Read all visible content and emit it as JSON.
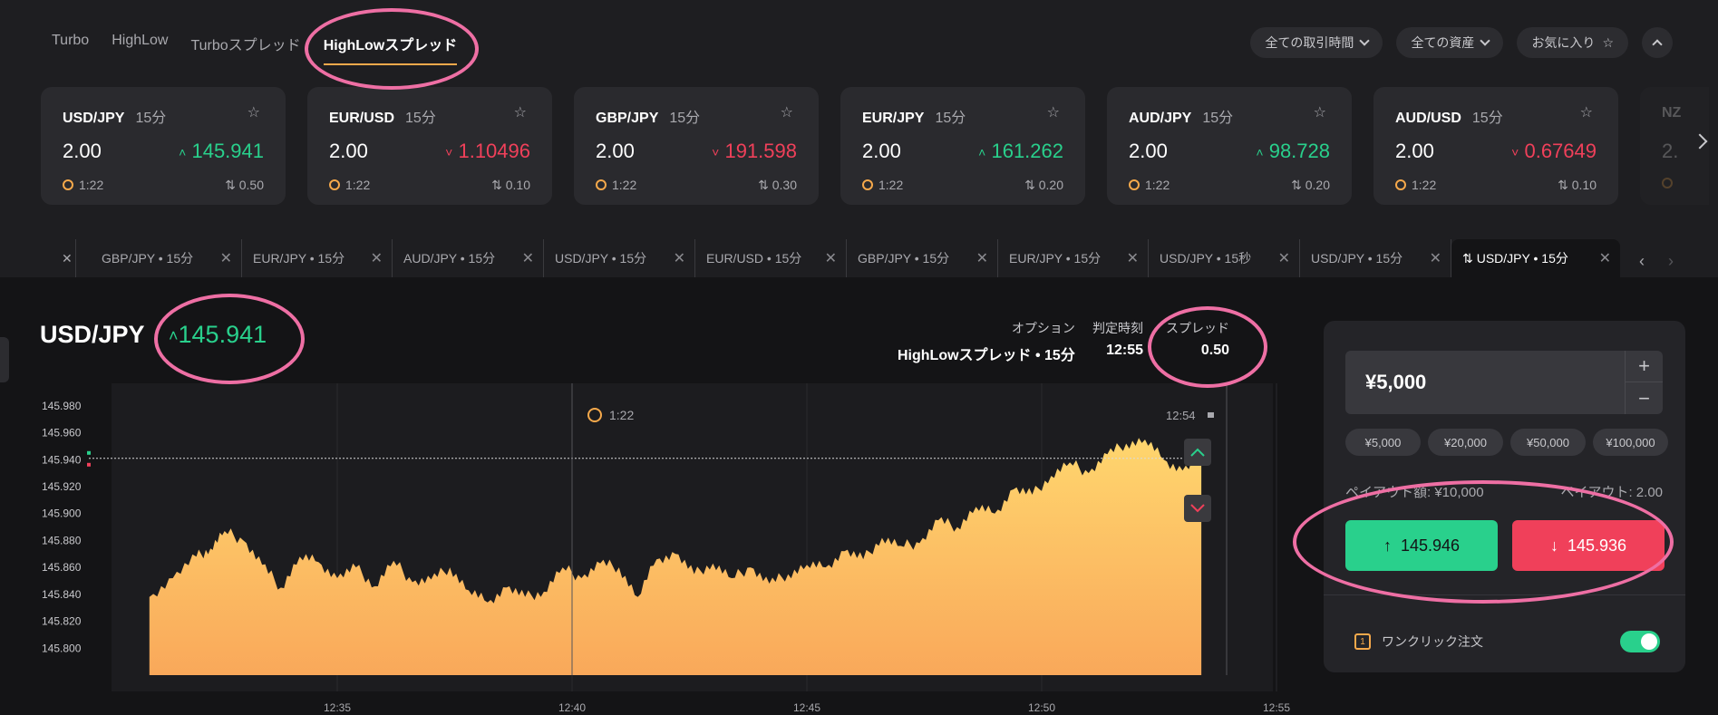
{
  "nav": {
    "tabs": [
      "Turbo",
      "HighLow",
      "Turboスプレッド",
      "HighLowスプレッド"
    ],
    "active_index": 3,
    "filters": [
      "全ての取引時間",
      "全ての資産",
      "お気に入り"
    ]
  },
  "cards": [
    {
      "pair": "USD/JPY",
      "duration": "15分",
      "payout": "2.00",
      "rate": "145.941",
      "direction": "up",
      "time": "1:22",
      "spread": "0.50"
    },
    {
      "pair": "EUR/USD",
      "duration": "15分",
      "payout": "2.00",
      "rate": "1.10496",
      "direction": "down",
      "time": "1:22",
      "spread": "0.10"
    },
    {
      "pair": "GBP/JPY",
      "duration": "15分",
      "payout": "2.00",
      "rate": "191.598",
      "direction": "down",
      "time": "1:22",
      "spread": "0.30"
    },
    {
      "pair": "EUR/JPY",
      "duration": "15分",
      "payout": "2.00",
      "rate": "161.262",
      "direction": "up",
      "time": "1:22",
      "spread": "0.20"
    },
    {
      "pair": "AUD/JPY",
      "duration": "15分",
      "payout": "2.00",
      "rate": "98.728",
      "direction": "up",
      "time": "1:22",
      "spread": "0.20"
    },
    {
      "pair": "AUD/USD",
      "duration": "15分",
      "payout": "2.00",
      "rate": "0.67649",
      "direction": "down",
      "time": "1:22",
      "spread": "0.10"
    },
    {
      "pair": "NZ",
      "duration": "",
      "payout": "2.",
      "rate": "",
      "direction": "up",
      "time": "",
      "spread": ""
    }
  ],
  "open_tabs": [
    "GBP/JPY • 15分",
    "EUR/JPY • 15分",
    "AUD/JPY • 15分",
    "USD/JPY • 15分",
    "EUR/USD • 15分",
    "GBP/JPY • 15分",
    "EUR/JPY • 15分",
    "USD/JPY • 15秒",
    "USD/JPY • 15分",
    "USD/JPY • 15分"
  ],
  "active_tab_index": 9,
  "asset": {
    "pair": "USD/JPY",
    "rate": "145.941",
    "option_label": "オプション",
    "option_value": "HighLowスプレッド • 15分",
    "expiry_label": "判定時刻",
    "expiry_value": "12:55",
    "spread_label": "スプレッド",
    "spread_value": "0.50",
    "countdown": "1:22",
    "close_time": "12:54"
  },
  "trade": {
    "amount": "¥5,000",
    "presets": [
      "¥5,000",
      "¥20,000",
      "¥50,000",
      "¥100,000"
    ],
    "payout_amount_text": "ペイアウト額: ¥10,000",
    "payout_rate_text": "ペイアウト: 2.00",
    "high_price": "145.946",
    "low_price": "145.936",
    "one_click_label": "ワンクリック注文",
    "one_click_enabled": true
  },
  "colors": {
    "up": "#29d08c",
    "down": "#f0405a",
    "accent": "#f6a94b",
    "highlight": "#ee6fa4"
  },
  "chart_data": {
    "type": "area",
    "xlabel": "",
    "ylabel": "",
    "x_ticks": [
      "12:35",
      "12:40",
      "12:45",
      "12:50",
      "12:55"
    ],
    "y_ticks": [
      "145.980",
      "145.960",
      "145.940",
      "145.920",
      "145.900",
      "145.880",
      "145.860",
      "145.840",
      "145.820",
      "145.800"
    ],
    "ylim": [
      145.78,
      145.99
    ],
    "current_value": 145.941,
    "series": [
      {
        "x_minutes": [
          0.0,
          0.5,
          1.0,
          1.3,
          1.6,
          2.0,
          2.4,
          2.8,
          3.2,
          3.6,
          4.0,
          4.4,
          4.8,
          5.2,
          5.6,
          6.0,
          6.4,
          6.8,
          7.2,
          7.6,
          8.0,
          8.4,
          8.8,
          9.2,
          9.6,
          10.0,
          10.4,
          10.8,
          11.2,
          11.6,
          12.0,
          12.4,
          12.8,
          13.2,
          13.6,
          14.0,
          14.4,
          14.8,
          15.2,
          15.6,
          16.0,
          16.4,
          16.8,
          17.2,
          17.6,
          18.0,
          18.4,
          18.8,
          19.2,
          19.6,
          20.0,
          20.4,
          20.8,
          21.2,
          21.6,
          22.0,
          22.4
        ],
        "values": [
          145.838,
          145.852,
          145.868,
          145.874,
          145.887,
          145.88,
          145.862,
          145.845,
          145.868,
          145.864,
          145.852,
          145.86,
          145.846,
          145.865,
          145.849,
          145.851,
          145.86,
          145.843,
          145.834,
          145.845,
          145.838,
          145.842,
          145.86,
          145.852,
          145.863,
          145.86,
          145.838,
          145.866,
          145.87,
          145.855,
          145.863,
          145.852,
          145.86,
          145.848,
          145.855,
          145.862,
          145.86,
          145.872,
          145.866,
          145.882,
          145.876,
          145.878,
          145.895,
          145.89,
          145.905,
          145.9,
          145.918,
          145.914,
          145.928,
          145.938,
          145.93,
          145.944,
          145.952,
          145.955,
          145.94,
          145.932,
          145.941
        ]
      }
    ]
  }
}
